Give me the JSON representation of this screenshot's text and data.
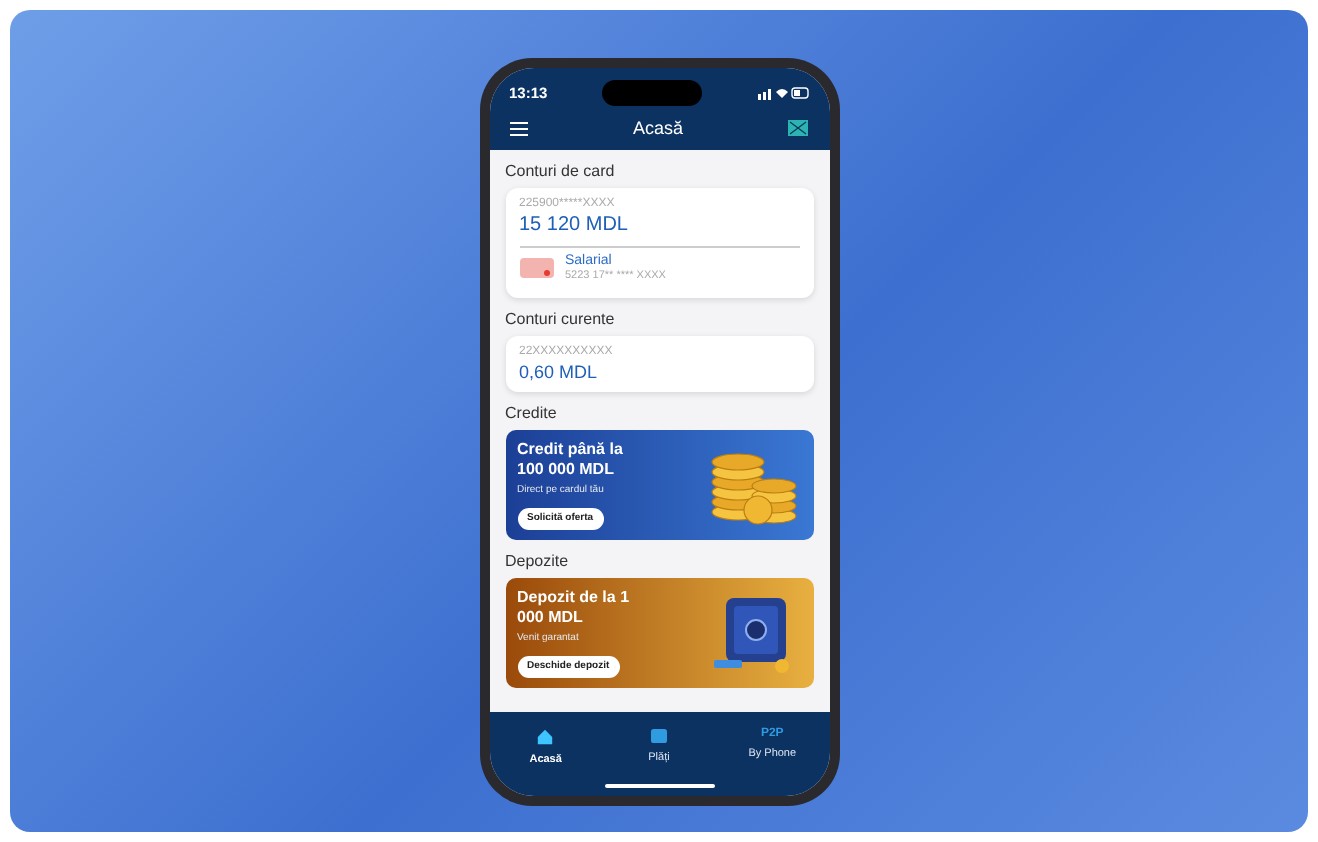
{
  "status_bar": {
    "time": "13:13"
  },
  "header": {
    "title": "Acasă"
  },
  "sections": [
    {
      "kind": "cards",
      "title": "Conturi de card",
      "account": "225900*****XXXX",
      "balance": "15 120 MDL",
      "card": {
        "name": "Salarial",
        "number": "5223 17** **** XXXX"
      }
    },
    {
      "kind": "account",
      "title": "Conturi curente",
      "account": "22XXXXXXXXXX",
      "balance": "0,60 MDL"
    },
    {
      "kind": "credit_promo",
      "title": "Credite",
      "headline": "Credit până la 100 000 MDL",
      "subtitle": "Direct pe cardul tău",
      "button": "Solicită oferta"
    },
    {
      "kind": "deposit_promo",
      "title": "Depozite",
      "headline": "Depozit de la 1 000 MDL",
      "subtitle": "Venit garantat",
      "button": "Deschide depozit"
    }
  ],
  "tab_bar": [
    {
      "label": "Acasă",
      "selected": true
    },
    {
      "label": "Plăți",
      "selected": false
    },
    {
      "label": "By Phone",
      "icon_text": "P2P",
      "selected": false
    }
  ]
}
